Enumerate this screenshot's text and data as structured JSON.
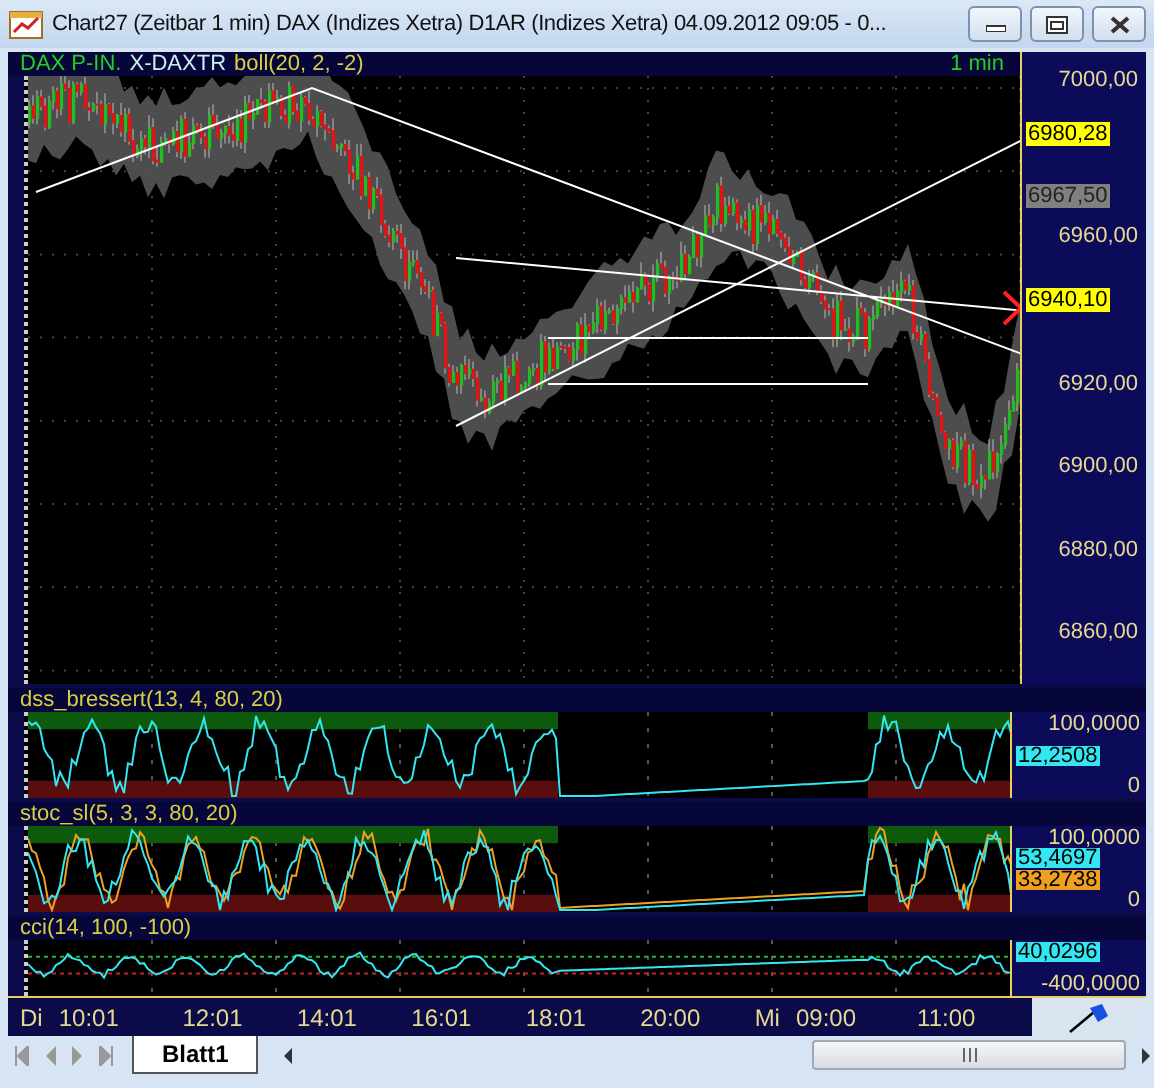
{
  "window": {
    "title": "Chart27 (Zeitbar 1 min)  DAX (Indizes Xetra) D1AR (Indizes Xetra) 04.09.2012 09:05 - 0..."
  },
  "price_panel": {
    "header": [
      {
        "text": "DAX P-IN.",
        "kind": "symbol"
      },
      {
        "text": "X-DAXTR",
        "kind": "name"
      },
      {
        "text": "boll(20, 2, -2)",
        "kind": "study"
      }
    ],
    "interval": "1 min",
    "axis": [
      {
        "text": "7000,00",
        "kind": "tick"
      },
      {
        "text": "6980,28",
        "kind": "last"
      },
      {
        "text": "6967,50",
        "kind": "prev"
      },
      {
        "text": "6960,00",
        "kind": "tick"
      },
      {
        "text": "6940,10",
        "kind": "last"
      },
      {
        "text": "6920,00",
        "kind": "tick"
      },
      {
        "text": "6900,00",
        "kind": "tick"
      },
      {
        "text": "6880,00",
        "kind": "tick"
      },
      {
        "text": "6860,00",
        "kind": "tick"
      }
    ]
  },
  "indicators": [
    {
      "title": "dss_bressert(13, 4, 80, 20)",
      "kind": "dss",
      "axis": [
        {
          "text": "100,0000",
          "kind": "tick"
        },
        {
          "text": "12,2508",
          "kind": "value",
          "color": "#33e6f2"
        },
        {
          "text": "0",
          "kind": "tick"
        }
      ]
    },
    {
      "title": "stoc_sl(5, 3, 3, 80, 20)",
      "kind": "stoc",
      "axis": [
        {
          "text": "100,0000",
          "kind": "tick"
        },
        {
          "text": "53,4697",
          "kind": "value",
          "color": "#33e6f2"
        },
        {
          "text": "33,2738",
          "kind": "value",
          "color": "#f0a020"
        },
        {
          "text": "0",
          "kind": "tick"
        }
      ]
    },
    {
      "title": "cci(14, 100, -100)",
      "kind": "cci",
      "axis": [
        {
          "text": "40,0296",
          "kind": "value",
          "color": "#33e6f2"
        },
        {
          "text": "-400,0000",
          "kind": "tick"
        }
      ]
    }
  ],
  "time_axis": [
    {
      "day": "Di",
      "time": "10:01"
    },
    {
      "time": "12:01"
    },
    {
      "time": "14:01"
    },
    {
      "time": "16:01"
    },
    {
      "time": "18:01"
    },
    {
      "time": "20:00"
    },
    {
      "day": "Mi",
      "time": "09:00"
    },
    {
      "time": "11:00"
    }
  ],
  "sheet_tabs": [
    {
      "label": "Blatt1",
      "selected": true
    }
  ]
}
